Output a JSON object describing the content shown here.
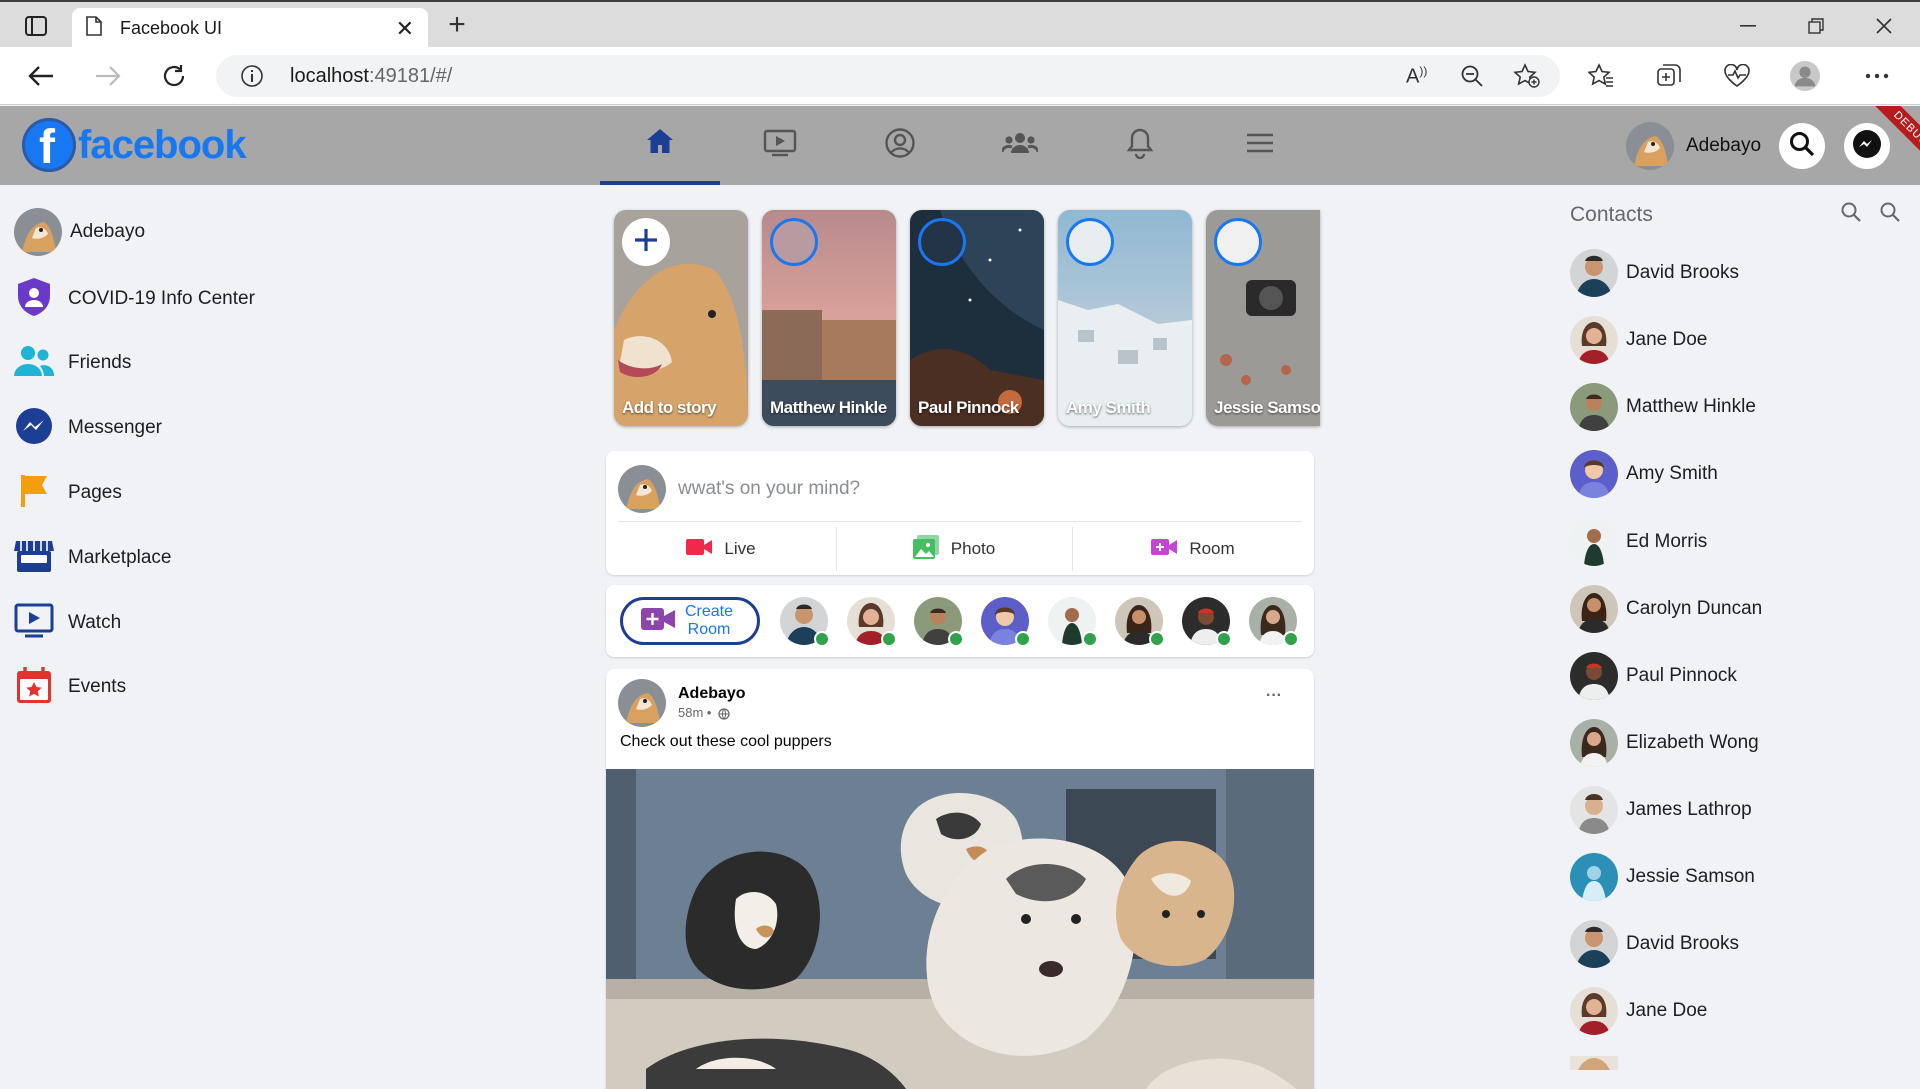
{
  "browser": {
    "tab_title": "Facebook UI",
    "url_host": "localhost",
    "url_rest": ":49181/#/"
  },
  "header": {
    "logo_text": "facebook",
    "user_name": "Adebayo",
    "debug_banner": "DEBUG",
    "nav_tabs": [
      "home-icon",
      "watch-icon",
      "profile-icon",
      "groups-icon",
      "notifications-icon",
      "menu-icon"
    ]
  },
  "left_sidebar": {
    "items": [
      {
        "label": "Adebayo"
      },
      {
        "label": "COVID-19 Info Center"
      },
      {
        "label": "Friends"
      },
      {
        "label": "Messenger"
      },
      {
        "label": "Pages"
      },
      {
        "label": "Marketplace"
      },
      {
        "label": "Watch"
      },
      {
        "label": "Events"
      }
    ]
  },
  "stories": [
    {
      "label": "Add to story"
    },
    {
      "label": "Matthew Hinkle"
    },
    {
      "label": "Paul Pinnock"
    },
    {
      "label": "Amy Smith"
    },
    {
      "label": "Jessie Samson"
    }
  ],
  "composer": {
    "placeholder": "wwat's on your mind?",
    "actions": [
      {
        "label": "Live",
        "color": "#f02849"
      },
      {
        "label": "Photo",
        "color": "#45bd62"
      },
      {
        "label": "Room",
        "color": "#c645d6"
      }
    ]
  },
  "rooms": {
    "create_label_1": "Create",
    "create_label_2": "Room"
  },
  "post": {
    "author": "Adebayo",
    "time": "58m •",
    "text": "Check out these cool puppers",
    "more": "···"
  },
  "contacts": {
    "title": "Contacts",
    "items": [
      "David Brooks",
      "Jane Doe",
      "Matthew Hinkle",
      "Amy Smith",
      "Ed Morris",
      "Carolyn Duncan",
      "Paul Pinnock",
      "Elizabeth Wong",
      "James Lathrop",
      "Jessie Samson",
      "David Brooks",
      "Jane Doe"
    ]
  },
  "colors": {
    "brand": "#1877f2",
    "active_tab": "#1c3f95",
    "header_bg": "#a7a7a7",
    "online": "#31a24c"
  }
}
